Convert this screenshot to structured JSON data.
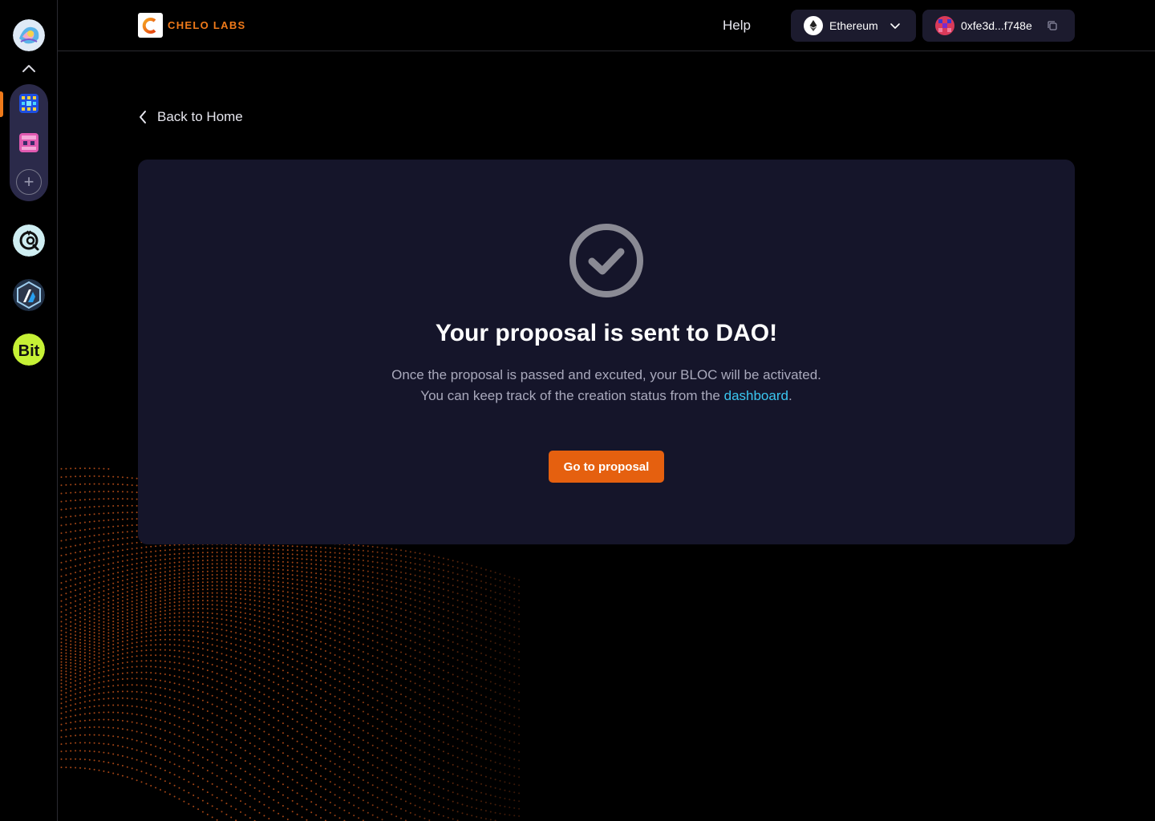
{
  "header": {
    "logo_text": "CHELO LABS",
    "help_label": "Help",
    "network": {
      "label": "Ethereum",
      "icon": "ethereum-icon"
    },
    "wallet": {
      "address": "0xfe3d...f748e",
      "copy_icon": "copy-icon"
    }
  },
  "nav": {
    "back_label": "Back to Home"
  },
  "confirmation": {
    "icon": "check-circle-icon",
    "title": "Your proposal is sent to DAO!",
    "line1": "Once the proposal is passed and excuted, your BLOC will be activated.",
    "line2_prefix": "You can keep track of the creation status from the ",
    "line2_link": "dashboard",
    "line2_suffix": ".",
    "cta_label": "Go to proposal"
  },
  "sidebar": {
    "coins": [
      {
        "name": "coin-c",
        "label": ""
      },
      {
        "name": "arbitrum",
        "label": ""
      },
      {
        "name": "bit",
        "label": "Bit"
      }
    ]
  },
  "colors": {
    "accent": "#e5600f",
    "link": "#3bc6f0",
    "card": "#15152a",
    "background": "#000000"
  }
}
